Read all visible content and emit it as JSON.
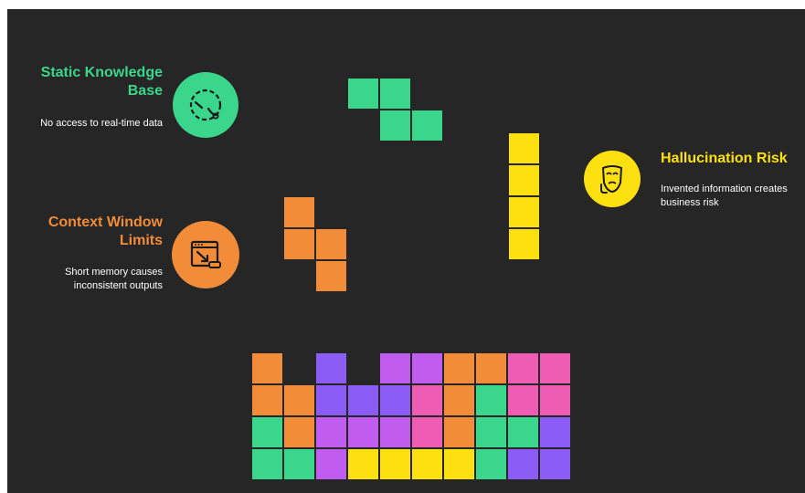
{
  "colors": {
    "background": "#262626",
    "green": "#3ad68c",
    "orange": "#f28c38",
    "yellow": "#fde010",
    "purple": "#8b5cf6",
    "violet": "#c05cf0",
    "pink": "#ee5cb4"
  },
  "callouts": {
    "static_knowledge": {
      "title": "Static Knowledge Base",
      "description": "No access to real-time data",
      "icon": "clock-gauge-icon"
    },
    "context_window": {
      "title": "Context Window Limits",
      "description": "Short memory causes inconsistent outputs",
      "icon": "window-resize-icon"
    },
    "hallucination": {
      "title": "Hallucination Risk",
      "description": "Invented information creates business risk",
      "icon": "mask-face-icon"
    }
  },
  "pieces": {
    "green_piece": "Z tetromino (green)",
    "orange_piece": "S tetromino (orange)",
    "yellow_piece": "I tetromino (yellow)"
  },
  "stack_rows": [
    [
      "orange",
      null,
      "purple",
      null,
      "violet",
      "violet",
      "orange",
      "orange",
      "pink",
      "pink"
    ],
    [
      "orange",
      "orange",
      "purple",
      "purple",
      "purple",
      "pink",
      "orange",
      "green",
      "pink",
      "pink"
    ],
    [
      "green",
      "orange",
      "violet",
      "violet",
      "violet",
      "pink",
      "orange",
      "green",
      "green",
      "purple"
    ],
    [
      "green",
      "green",
      "violet",
      "yellow",
      "yellow",
      "yellow",
      "yellow",
      "green",
      "purple",
      "purple"
    ]
  ]
}
